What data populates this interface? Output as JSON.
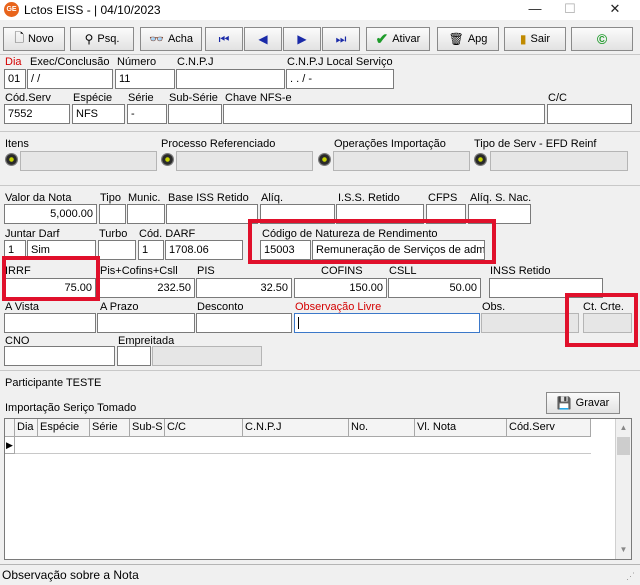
{
  "window": {
    "title": "Lctos EISS - |  04/10/2023",
    "icon_text": "GE"
  },
  "toolbar": {
    "novo": "Novo",
    "psq": "Psq.",
    "acha": "Acha",
    "ativar": "Ativar",
    "apg": "Apg",
    "sair": "Sair"
  },
  "row1": {
    "dia_label": "Dia",
    "dia_value": "01",
    "exec_label": "Exec/Conclusão",
    "exec_value": "  /  /",
    "numero_label": "Número",
    "numero_value": "11",
    "cnpj_label": "C.N.P.J",
    "cnpj_value": "",
    "cnpj_local_label": "C.N.P.J Local Serviço",
    "cnpj_local_value": "  .   .   /   -"
  },
  "row2": {
    "cod_serv_label": "Cód.Serv",
    "cod_serv_value": "7552",
    "especie_label": "Espécie",
    "especie_value": "NFS",
    "serie_label": "Série",
    "serie_value": "-",
    "sub_serie_label": "Sub-Série",
    "sub_serie_value": "",
    "chave_label": "Chave NFS-e",
    "chave_value": "",
    "cc_label": "C/C",
    "cc_value": ""
  },
  "row3": {
    "itens_label": "Itens",
    "processo_label": "Processo Referenciado",
    "operacoes_label": "Operações Importação",
    "tipo_serv_label": "Tipo de Serv - EFD Reinf"
  },
  "row4": {
    "valor_nota_label": "Valor da Nota",
    "valor_nota_value": "5,000.00",
    "tipo_label": "Tipo",
    "munic_label": "Munic.",
    "base_iss_label": "Base ISS Retido",
    "aliq_label": "Alíq.",
    "iss_retido_label": "I.S.S. Retido",
    "cfps_label": "CFPS",
    "aliq_snac_label": "Alíq. S. Nac."
  },
  "row5": {
    "juntar_label": "Juntar Darf",
    "juntar_num": "1",
    "juntar_value": "Sim",
    "turbo_label": "Turbo",
    "cod_darf_label": "Cód. DARF",
    "cod_darf_num": "1",
    "cod_darf_value": "1708.06",
    "natureza_label": "Código de Natureza de Rendimento",
    "natureza_code": "15003",
    "natureza_desc": "Remuneração de Serviços de admi"
  },
  "row6": {
    "irrf_label": "IRRF",
    "irrf_value": "75.00",
    "pis_cofins_label": "Pis+Cofins+Csll",
    "pis_cofins_value": "232.50",
    "pis_label": "PIS",
    "pis_value": "32.50",
    "cofins_label": "COFINS",
    "cofins_value": "150.00",
    "csll_label": "CSLL",
    "csll_value": "50.00",
    "inss_label": "INSS Retido"
  },
  "row7": {
    "a_vista_label": "A Vista",
    "a_prazo_label": "A Prazo",
    "desconto_label": "Desconto",
    "obs_livre_label": "Observação Livre",
    "obs_label": "Obs.",
    "ct_crte_label": "Ct. Crte."
  },
  "row8": {
    "cno_label": "CNO",
    "empreitada_label": "Empreitada"
  },
  "participante": "Participante TESTE",
  "importacao": "Importação Seriço Tomado",
  "gravar": "Gravar",
  "grid_columns": [
    "Dia",
    "Espécie",
    "Série",
    "Sub-S",
    "C/C",
    "C.N.P.J",
    "No.",
    "Vl. Nota",
    "Cód.Serv"
  ],
  "statusbar": "Observação sobre a Nota",
  "colors": {
    "highlight": "#e0102b",
    "required_label": "#d40000"
  }
}
